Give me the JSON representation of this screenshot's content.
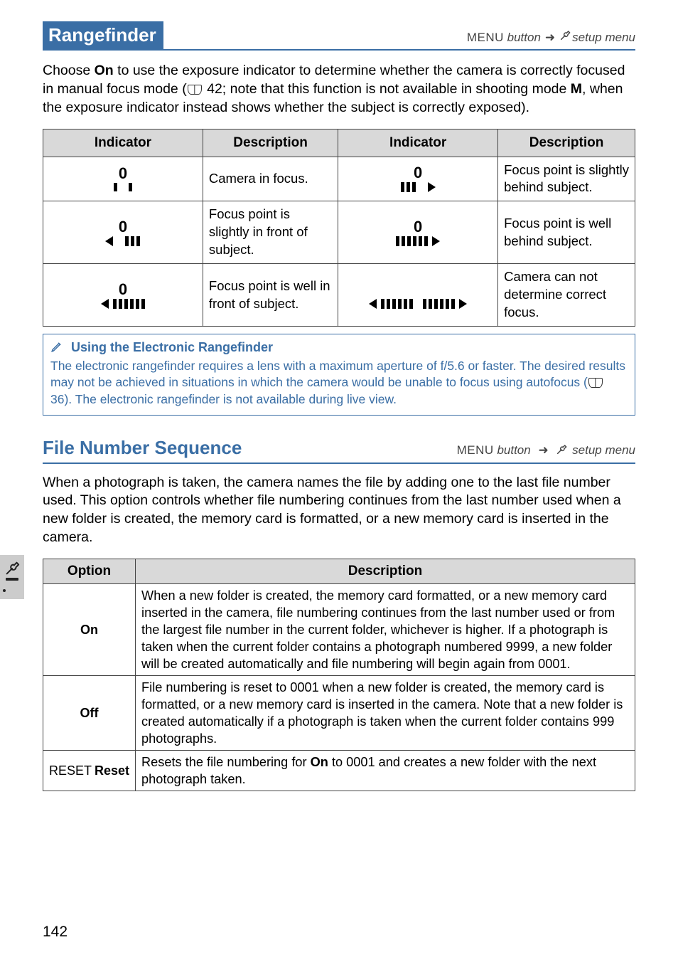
{
  "section1": {
    "title": "Rangefinder",
    "menu_button": "MENU",
    "button_word": "button",
    "setup_menu": "setup menu",
    "body": "Choose <b>On</b> to use the exposure indicator to determine whether the camera is correctly focused in manual focus mode (<book></book> 42; note that this function is not available in shooting mode <b>M</b>, when the exposure indicator instead shows whether the subject is correctly exposed)."
  },
  "ind_table": {
    "headers": [
      "Indicator",
      "Description",
      "Indicator",
      "Description"
    ],
    "rows": [
      {
        "l": "in-focus",
        "ld": "Camera in focus.",
        "r": "slight-behind",
        "rd": "Focus point is slightly behind subject."
      },
      {
        "l": "slight-front",
        "ld": "Focus point is slightly in front of subject.",
        "r": "well-behind",
        "rd": "Focus point is well behind subject."
      },
      {
        "l": "well-front",
        "ld": "Focus point is well in front of subject.",
        "r": "cannot",
        "rd": "Camera can not determine correct focus."
      }
    ]
  },
  "note": {
    "title": "Using the Electronic Rangefinder",
    "body": "The electronic rangefinder requires a lens with a maximum aperture of f/5.6 or faster.  The desired results may not be achieved in situations in which the camera would be unable to focus using autofocus (<book></book> 36).  The electronic rangefinder is not available during live view."
  },
  "section2": {
    "title": "File Number Sequence",
    "menu_button": "MENU",
    "button_word": "button",
    "setup_menu": "setup menu",
    "body": "When a photograph is taken, the camera names the file by adding one to the last file number used.  This option controls whether file numbering continues from the last number used when a new folder is created, the memory card is formatted, or a new memory card is inserted in the camera."
  },
  "opts_table": {
    "headers": [
      "Option",
      "Description"
    ],
    "rows": [
      {
        "opt": "On",
        "opt_prefix": "",
        "desc": "When a new folder is created, the memory card formatted, or a new memory card inserted in the camera, file numbering continues from the last number used or from the largest file number in the current folder, whichever is higher.  If a photograph is taken when the current folder contains a photograph numbered 9999, a new folder will be created automatically and file numbering will begin again from 0001."
      },
      {
        "opt": "Off",
        "opt_prefix": "",
        "desc": "File numbering is reset to 0001 when a new folder is created, the memory card is formatted, or a new memory card is inserted in the camera.  Note that a new folder is created automatically if a photograph is taken when the current folder contains 999 photographs."
      },
      {
        "opt": "Reset",
        "opt_prefix": "RESET",
        "desc": "Resets the file numbering for <b>On</b> to 0001 and creates a new folder with the next photograph taken."
      }
    ]
  },
  "page_num": "142"
}
